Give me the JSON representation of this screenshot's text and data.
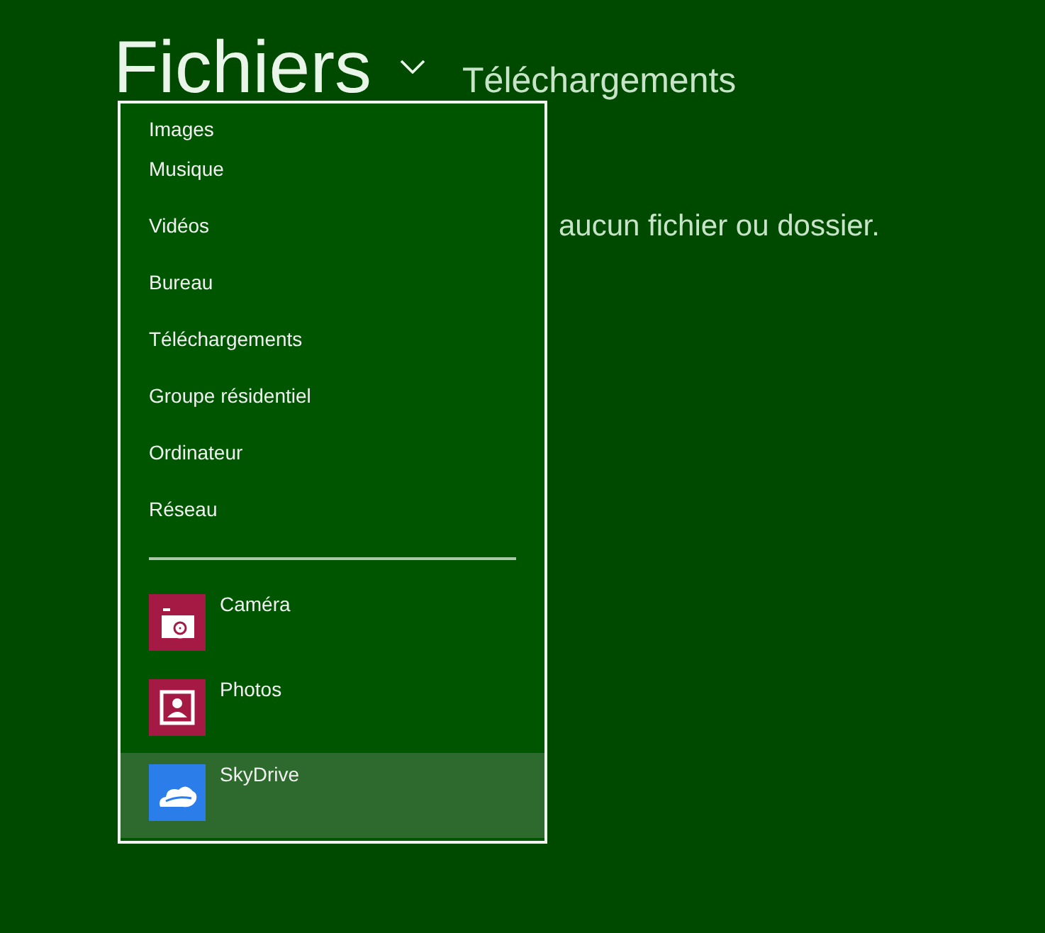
{
  "header": {
    "title": "Fichiers",
    "location": "Téléchargements"
  },
  "message": "aucun fichier ou dossier.",
  "menu": {
    "places": [
      {
        "label": "Images"
      },
      {
        "label": "Musique"
      },
      {
        "label": "Vidéos"
      },
      {
        "label": "Bureau"
      },
      {
        "label": "Téléchargements"
      },
      {
        "label": "Groupe résidentiel"
      },
      {
        "label": "Ordinateur"
      },
      {
        "label": "Réseau"
      }
    ],
    "apps": [
      {
        "label": "Caméra",
        "kind": "camera",
        "color": "#a51a45",
        "selected": false
      },
      {
        "label": "Photos",
        "kind": "photos",
        "color": "#a51a45",
        "selected": false
      },
      {
        "label": "SkyDrive",
        "kind": "cloud",
        "color": "#2b7de9",
        "selected": true
      }
    ]
  }
}
